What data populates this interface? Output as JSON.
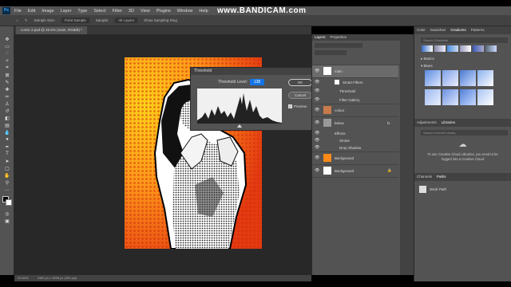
{
  "watermark": "www.BANDICAM.com",
  "menu": [
    "File",
    "Edit",
    "Image",
    "Layer",
    "Type",
    "Select",
    "Filter",
    "3D",
    "View",
    "Plugins",
    "Window",
    "Help"
  ],
  "options": {
    "sample_size_label": "Sample Size:",
    "sample_size_value": "Point Sample",
    "sample_label": "Sample:",
    "all_layers": "All Layers",
    "show_ring": "Show Sampling Ring"
  },
  "document": {
    "tab": "comic 2.psd @ 20.6% (main, RGB/8) *",
    "status_zoom": "20.83%",
    "status_info": "2483 px x 3508 px (300 ppi)"
  },
  "threshold": {
    "title": "Threshold",
    "level_label": "Threshold Level:",
    "level_value": "138",
    "ok": "OK",
    "cancel": "Cancel",
    "preview": "Preview"
  },
  "layers_panel": {
    "tabs": [
      "Layers",
      "Properties"
    ],
    "rows": [
      {
        "name": "main",
        "type": "smart"
      },
      {
        "name": "Smart Filters",
        "type": "sub"
      },
      {
        "name": "Threshold",
        "type": "sub"
      },
      {
        "name": "Filter Gallery",
        "type": "sub"
      },
      {
        "name": "colour",
        "type": "layer"
      },
      {
        "name": "below",
        "type": "layer"
      },
      {
        "name": "Effects",
        "type": "sub"
      },
      {
        "name": "Stroke",
        "type": "sub"
      },
      {
        "name": "Drop Shadow",
        "type": "sub"
      },
      {
        "name": "Background",
        "type": "layer"
      },
      {
        "name": "Background",
        "type": "layer"
      }
    ]
  },
  "right_panel": {
    "top_tabs": [
      "Color",
      "Swatches",
      "Gradients",
      "Patterns"
    ],
    "search_placeholder": "Search Gradients",
    "groups": [
      "Basics",
      "Blues"
    ],
    "mid_tabs": [
      "Adjustments",
      "Libraries"
    ],
    "libraries_search_placeholder": "Search Current Library",
    "libraries_message": "To use Creative Cloud Libraries, you need to be logged into a Creative Cloud",
    "bottom_tabs": [
      "Channels",
      "Paths"
    ],
    "path_item": "Work Path"
  }
}
